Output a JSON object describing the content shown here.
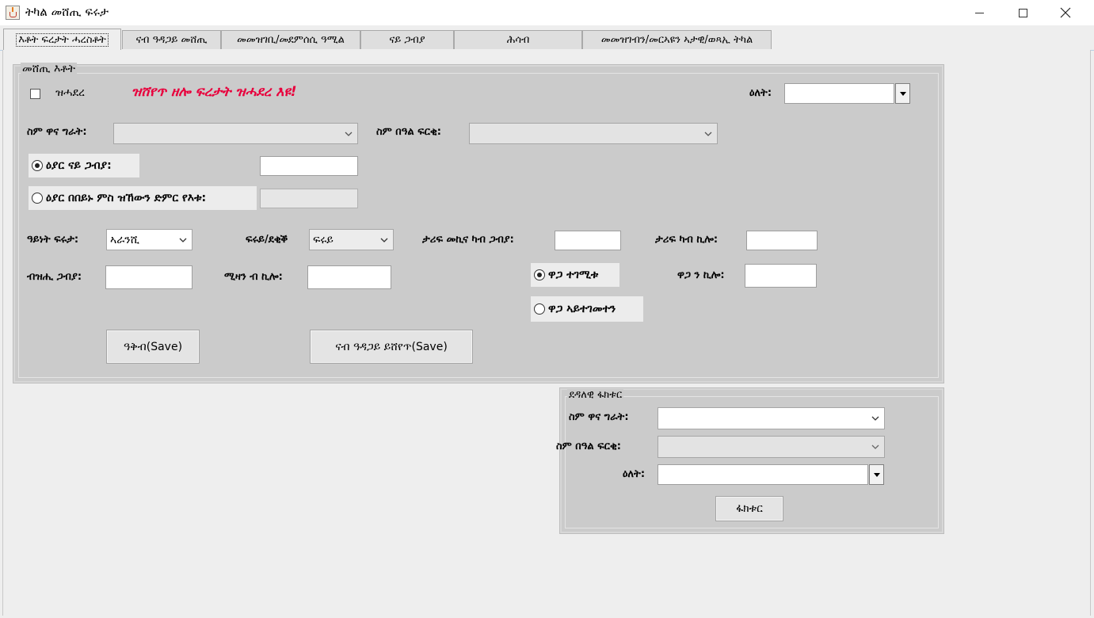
{
  "window": {
    "title": "ትካል መሸጢ ፍሩታ",
    "controls": {
      "minimize_icon": "minimize-icon",
      "maximize_icon": "maximize-icon",
      "close_icon": "close-icon"
    }
  },
  "tabs": [
    {
      "label": "እቶት ፍረታት ሓረስቶት",
      "active": true
    },
    {
      "label": "ናብ ዓዳጋይ መሸጢ",
      "active": false
    },
    {
      "label": "መመዝገቢ/መደምሰሲ ዓሚል",
      "active": false
    },
    {
      "label": "ናይ ጋብያ",
      "active": false
    },
    {
      "label": "ሕሳብ",
      "active": false
    },
    {
      "label": "መመዝገብን/መርኣዩን ኣታዊ/ወጻኢ ትካል",
      "active": false
    }
  ],
  "sales_panel": {
    "title": "መሸጢ እቶት",
    "overdue_checkbox_label": "ዝሓደረ",
    "overdue_checked": false,
    "warning_text": "ዝሸየጥ ዘሎ ፍረታት ዝሓደረ እዩ!",
    "date_label": "ዕለት:",
    "date_value": "",
    "customer_label": "ስም ዋና ግራት:",
    "customer_value": "",
    "owner_label": "ስም በዓል ፍርቂ:",
    "owner_value": "",
    "radio_gabya_label": "ዕያር ናይ ጋብያ:",
    "radio_gabya_selected": true,
    "radio_gabya_value": "",
    "radio_sum_label": "ዕያር በበይኑ ምስ ዝኸውን ድምር የእቱ:",
    "radio_sum_selected": false,
    "radio_sum_value": "",
    "fruit_type_label": "ዓይነት ፍሩታ:",
    "fruit_type_value": "ኣራንሺ",
    "fruit_grade_label": "ፍሩይ/ደቂቕ",
    "fruit_grade_value": "ፍሩይ",
    "tariff_car_label": "ታሪፍ መኪና ካብ ጋብያ:",
    "tariff_car_value": "",
    "tariff_kilo_label": "ታሪፍ ካብ ኪሎ:",
    "tariff_kilo_value": "",
    "qty_label": "ብዝሒ ጋብያ:",
    "qty_value": "",
    "weight_label": "ሚዛን ብ ኪሎ:",
    "weight_value": "",
    "price_fixed_label": "ዋጋ ተገሚቱ",
    "price_fixed_selected": true,
    "price_unfixed_label": "ዋጋ ኣይተገመተን",
    "price_unfixed_selected": false,
    "price_kilo_label": "ዋጋ ን ኪሎ:",
    "price_kilo_value": "",
    "save_button": "ዓቅብ(Save)",
    "save_trader_button": "ናብ ዓዳጋይ ይሸየጥ(Save)"
  },
  "invoice_panel": {
    "title": "ደዳለዊ ፋክቱር",
    "customer_label": "ስም ዋና ግራት:",
    "customer_value": "",
    "owner_label": "ስም በዓል ፍርቂ:",
    "owner_value": "",
    "date_label": "ዕለት:",
    "date_value": "",
    "invoice_button": "ፋክቱር"
  },
  "icons": {
    "app": "java-cup-icon",
    "dropdown": "chevron-down-icon",
    "date_dropdown": "triangle-down-icon"
  }
}
